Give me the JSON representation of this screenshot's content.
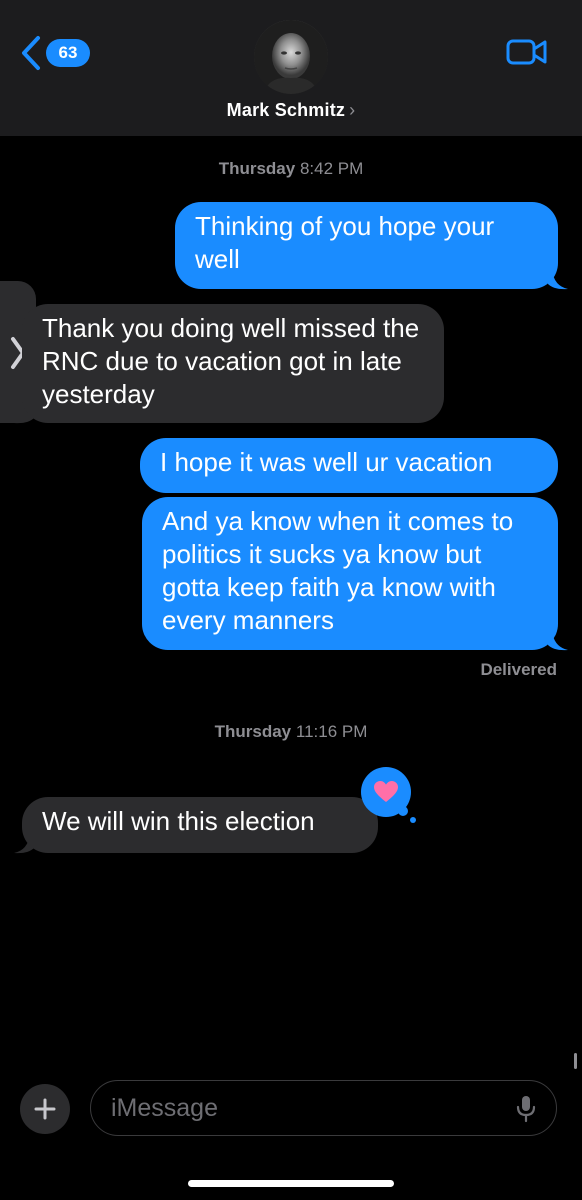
{
  "header": {
    "back_count": "63",
    "contact_name": "Mark Schmitz",
    "name_chevron": "›",
    "icons": {
      "back": "chevron-left-icon",
      "video": "video-camera-icon",
      "avatar": "contact-photo"
    },
    "accent_color": "#1a8cff"
  },
  "conversation": {
    "timestamp_1": {
      "day": "Thursday",
      "time": "8:42 PM"
    },
    "messages_1": [
      {
        "from": "me",
        "text": "Thinking of you hope your well"
      },
      {
        "from": "them",
        "text": "Thank you doing well missed the RNC due to vacation got in late yesterday"
      },
      {
        "from": "me",
        "text": "I hope it was well ur vacation"
      },
      {
        "from": "me",
        "text": "And ya know when it comes to politics it sucks ya know but gotta keep faith ya know with every manners"
      }
    ],
    "status": "Delivered",
    "timestamp_2": {
      "day": "Thursday",
      "time": "11:16 PM"
    },
    "messages_2": [
      {
        "from": "them",
        "text": "We will win this election",
        "tapback": "heart-icon"
      }
    ],
    "colors": {
      "sent_bubble": "#1a8cff",
      "received_bubble": "#2c2c2e",
      "tapback_heart": "#ff6fa8"
    }
  },
  "composer": {
    "placeholder": "iMessage",
    "icons": {
      "plus": "plus-icon",
      "mic": "microphone-icon"
    }
  }
}
